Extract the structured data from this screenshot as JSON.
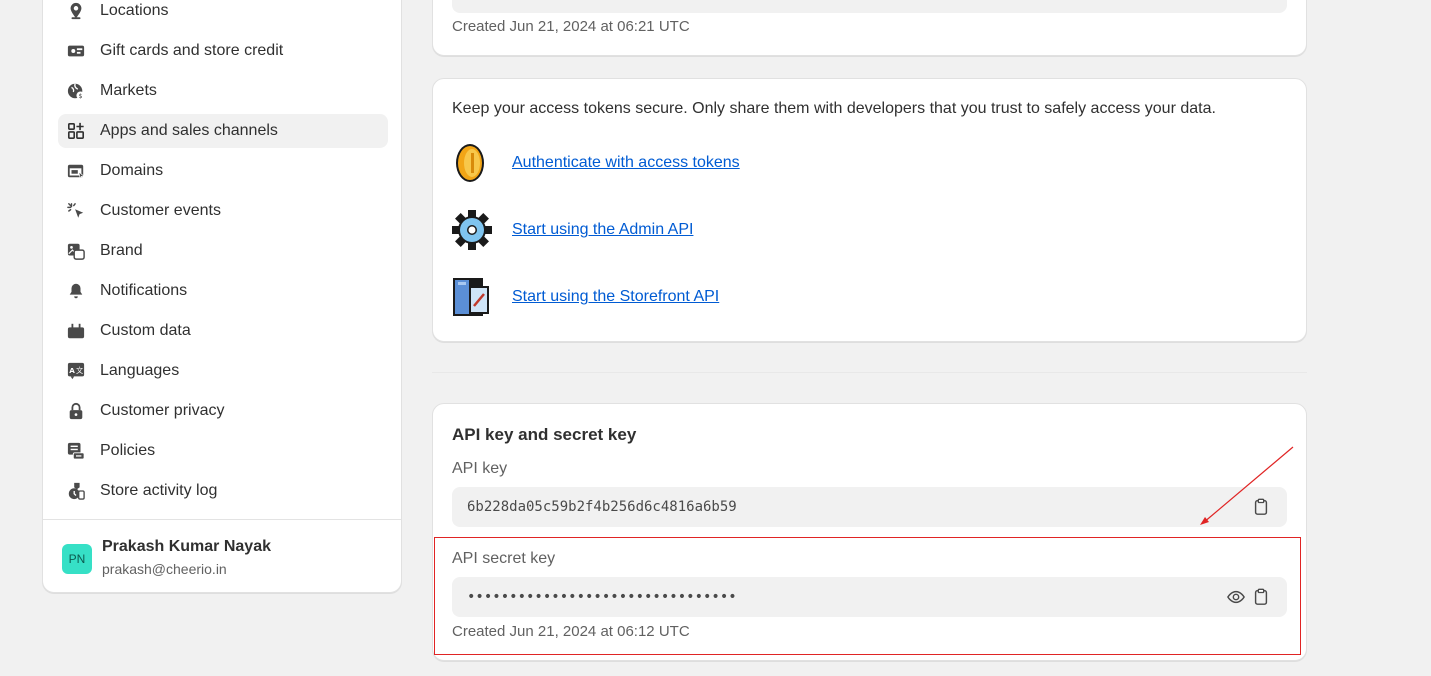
{
  "sidebar": {
    "items": [
      {
        "label": "Locations",
        "icon": "location-pin-icon"
      },
      {
        "label": "Gift cards and store credit",
        "icon": "gift-card-icon"
      },
      {
        "label": "Markets",
        "icon": "globe-icon"
      },
      {
        "label": "Apps and sales channels",
        "icon": "apps-icon",
        "active": true
      },
      {
        "label": "Domains",
        "icon": "domain-icon"
      },
      {
        "label": "Customer events",
        "icon": "cursor-click-icon"
      },
      {
        "label": "Brand",
        "icon": "brand-image-icon"
      },
      {
        "label": "Notifications",
        "icon": "bell-icon"
      },
      {
        "label": "Custom data",
        "icon": "database-icon"
      },
      {
        "label": "Languages",
        "icon": "language-icon"
      },
      {
        "label": "Customer privacy",
        "icon": "lock-icon"
      },
      {
        "label": "Policies",
        "icon": "policy-icon"
      },
      {
        "label": "Store activity log",
        "icon": "activity-log-icon"
      }
    ],
    "user": {
      "initials": "PN",
      "name": "Prakash Kumar Nayak",
      "email": "prakash@cheerio.in"
    }
  },
  "token_card": {
    "created": "Created Jun 21, 2024 at 06:21 UTC"
  },
  "security_card": {
    "intro": "Keep your access tokens secure. Only share them with developers that you trust to safely access your data.",
    "links": [
      {
        "label": "Authenticate with access tokens",
        "icon": "coin-icon"
      },
      {
        "label": "Start using the Admin API",
        "icon": "gear-icon"
      },
      {
        "label": "Start using the Storefront API",
        "icon": "storefront-icon"
      }
    ]
  },
  "api_card": {
    "title": "API key and secret key",
    "api_key_label": "API key",
    "api_key_value": "6b228da05c59b2f4b256d6c4816a6b59",
    "secret_label": "API secret key",
    "secret_value": "••••••••••••••••••••••••••••••••",
    "created": "Created Jun 21, 2024 at 06:12 UTC"
  },
  "colors": {
    "link": "#005bd3",
    "annotation": "#e02424",
    "avatar": "#36e0c6"
  }
}
